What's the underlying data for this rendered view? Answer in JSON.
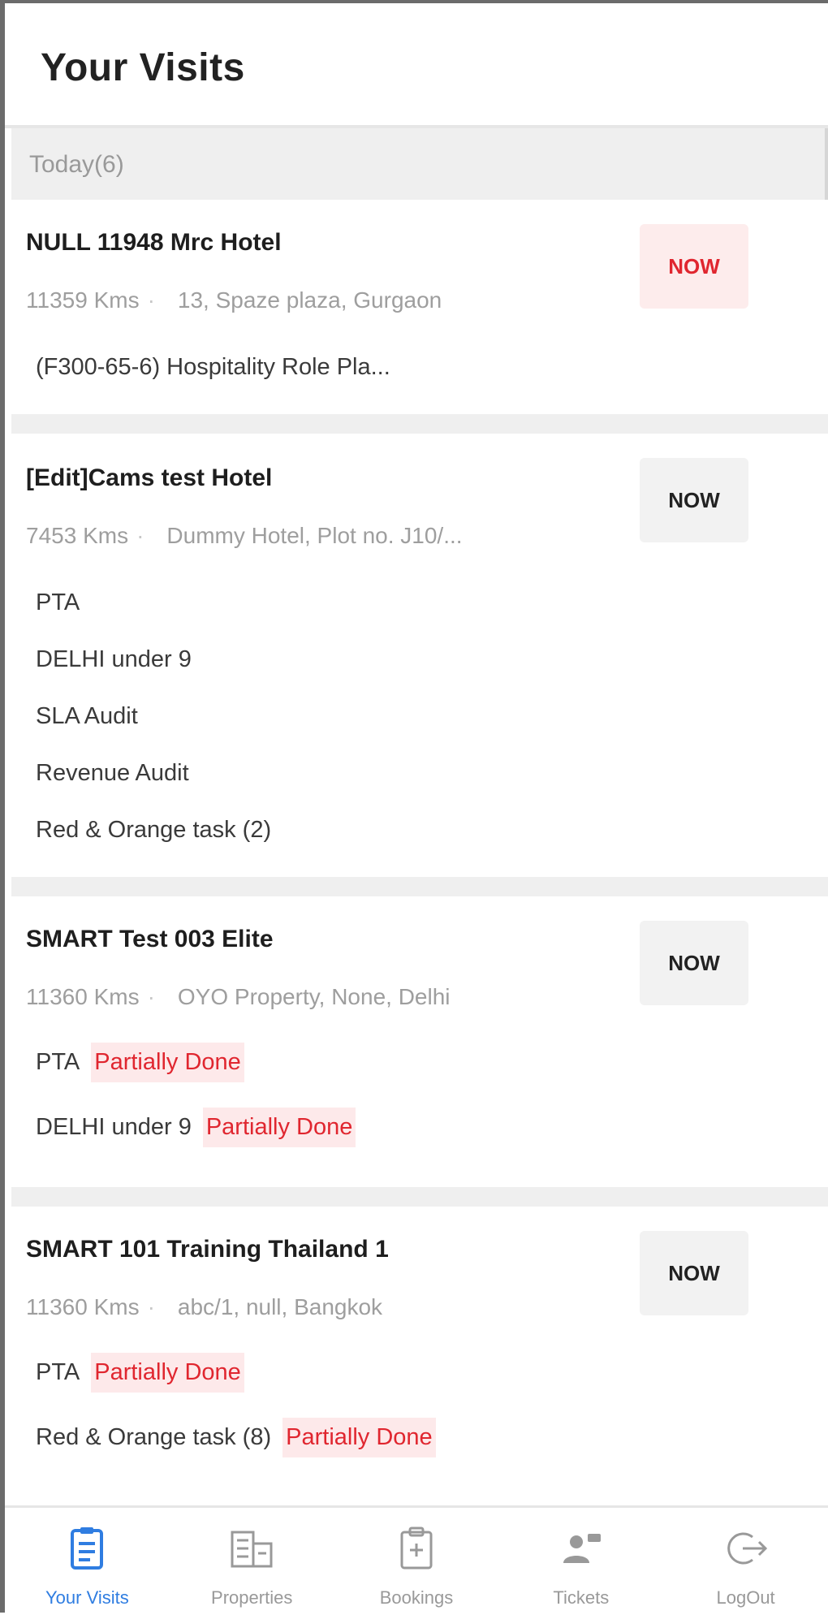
{
  "header": {
    "title": "Your Visits"
  },
  "section": {
    "label": "Today(6)"
  },
  "visits": [
    {
      "title": "NULL 11948 Mrc Hotel",
      "distance": "11359 Kms",
      "address": "13, Spaze plaza, Gurgaon",
      "action": "NOW",
      "description": "(F300-65-6) Hospitality Role Pla..."
    },
    {
      "title": "[Edit]Cams test Hotel",
      "distance": "7453 Kms",
      "address": "Dummy Hotel, Plot no. J10/...",
      "action": "NOW",
      "tasks": [
        {
          "name": "PTA"
        },
        {
          "name": "DELHI under 9"
        },
        {
          "name": "SLA Audit"
        },
        {
          "name": "Revenue Audit"
        },
        {
          "name": "Red & Orange task (2)"
        }
      ]
    },
    {
      "title": "SMART Test 003 Elite",
      "distance": "11360 Kms",
      "address": "OYO Property, None, Delhi",
      "action": "NOW",
      "tasks": [
        {
          "name": "PTA",
          "status": "Partially Done"
        },
        {
          "name": "DELHI under 9",
          "status": "Partially Done"
        }
      ]
    },
    {
      "title": "SMART 101 Training Thailand 1",
      "distance": "11360 Kms",
      "address": "abc/1, null, Bangkok",
      "action": "NOW",
      "tasks": [
        {
          "name": "PTA",
          "status": "Partially Done"
        },
        {
          "name": "Red & Orange task (8)",
          "status": "Partially Done"
        }
      ]
    }
  ],
  "nav": {
    "items": [
      {
        "label": "Your Visits",
        "icon": "clipboard-list-icon",
        "active": true
      },
      {
        "label": "Properties",
        "icon": "building-icon"
      },
      {
        "label": "Bookings",
        "icon": "clipboard-icon"
      },
      {
        "label": "Tickets",
        "icon": "people-icon"
      },
      {
        "label": "LogOut",
        "icon": "logout-icon"
      }
    ]
  },
  "colors": {
    "accent": "#2f7de1",
    "now_red": "#e0262f",
    "badge_bg": "#fde9ea",
    "section_bg": "#efefef"
  }
}
